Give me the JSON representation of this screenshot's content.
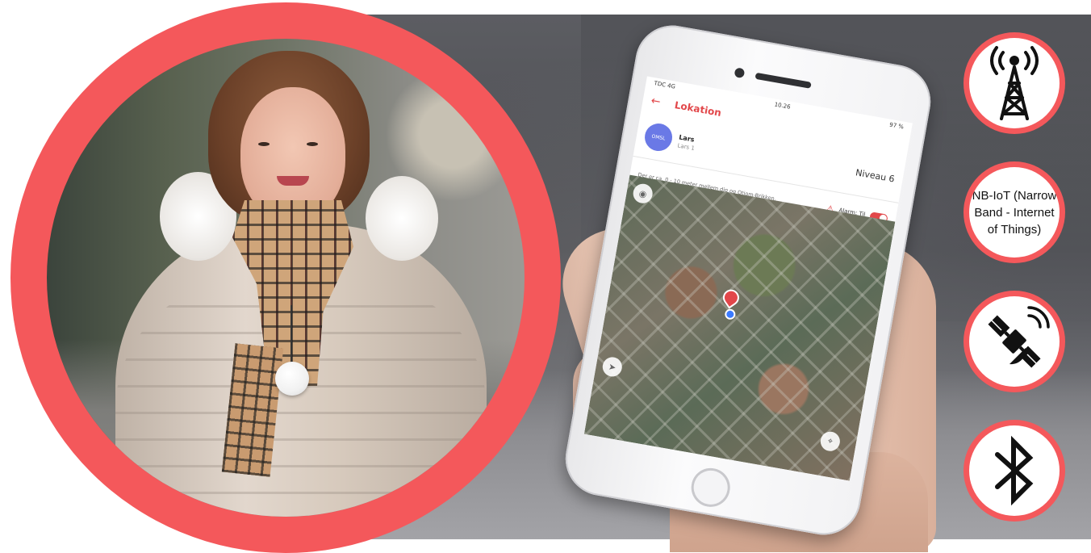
{
  "phone_screen": {
    "status": {
      "carrier": "TDC 4G",
      "time": "10.26",
      "battery": "97 %"
    },
    "header": {
      "back_icon": "arrow-left-icon",
      "title": "Lokation"
    },
    "profile": {
      "avatar_text": "OMSL",
      "name": "Lars",
      "subtitle": "Lars 1",
      "level": "Niveau 6"
    },
    "alarm": {
      "info": "Der er ca. 0 - 10 meter mellem dig og Otiom-Brikken.",
      "label": "Alarm: Til",
      "enabled": true
    },
    "map": {
      "pin_icon": "location-pin-icon",
      "recenter_icon": "crosshair-icon"
    }
  },
  "badges": [
    {
      "icon": "cell-tower-icon"
    },
    {
      "text": "NB-IoT (Narrow Band - Internet of Things)"
    },
    {
      "icon": "satellite-icon"
    },
    {
      "icon": "bluetooth-icon"
    }
  ],
  "colors": {
    "accent": "#f4585b",
    "app_red": "#e2474a"
  }
}
